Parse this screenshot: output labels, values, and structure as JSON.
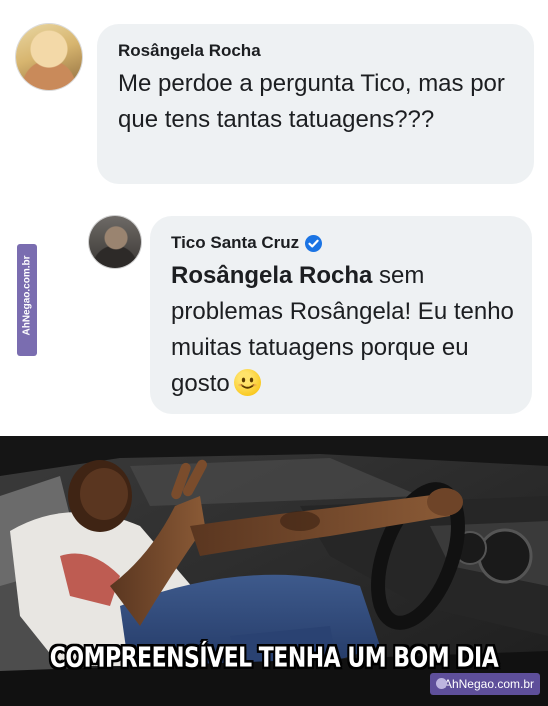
{
  "comment1": {
    "author": "Rosângela Rocha",
    "text": "Me perdoe a pergunta Tico, mas por que tens tantas tatuagens???"
  },
  "reply": {
    "author": "Tico Santa Cruz",
    "verified_icon": "verified-badge-icon",
    "mention": "Rosângela Rocha",
    "text": " sem problemas Rosângela! Eu tenho muitas tatuagens porque eu gosto",
    "emoji": "smiling-face-icon"
  },
  "watermark": {
    "side": "AhNegao.com.br",
    "corner": "AhNegao.com.br"
  },
  "meme": {
    "caption": "COMPREENSÍVEL TENHA UM BOM DIA"
  },
  "colors": {
    "bubble": "#eef1f3",
    "verified": "#1b74e4",
    "watermark": "#7a6db0"
  }
}
